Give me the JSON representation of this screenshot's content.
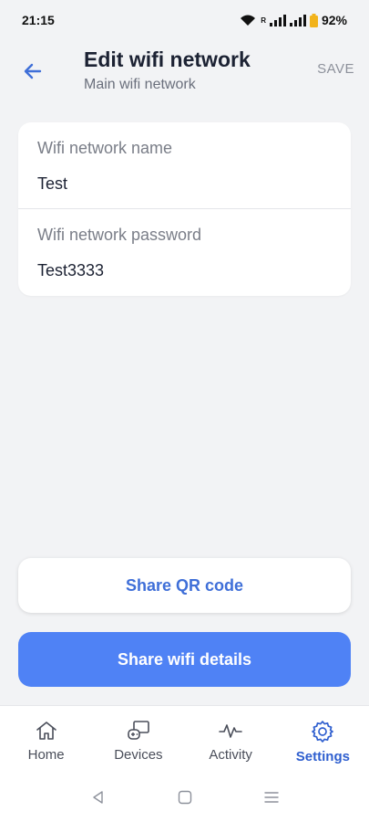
{
  "status_bar": {
    "time": "21:15",
    "roaming_indicator": "R",
    "battery": "92%",
    "icons": [
      "wifi-icon",
      "signal-icon",
      "signal-icon",
      "battery-icon"
    ]
  },
  "header": {
    "title": "Edit wifi network",
    "subtitle": "Main wifi network",
    "save_label": "SAVE",
    "back_icon": "arrow-left-icon"
  },
  "form": {
    "fields": [
      {
        "label": "Wifi network name",
        "value": "Test"
      },
      {
        "label": "Wifi network password",
        "value": "Test3333"
      }
    ]
  },
  "actions": {
    "share_qr_label": "Share QR code",
    "share_details_label": "Share wifi details"
  },
  "bottom_nav": {
    "items": [
      {
        "label": "Home",
        "icon": "home-icon",
        "active": false
      },
      {
        "label": "Devices",
        "icon": "devices-icon",
        "active": false
      },
      {
        "label": "Activity",
        "icon": "activity-icon",
        "active": false
      },
      {
        "label": "Settings",
        "icon": "gear-icon",
        "active": true
      }
    ]
  },
  "system_nav": {
    "icons": [
      "back-triangle-icon",
      "home-square-icon",
      "recents-menu-icon"
    ]
  },
  "colors": {
    "accent": "#4f82f5",
    "accent_text": "#3f6fd8",
    "active_nav": "#2f5fcf",
    "background": "#f2f3f5"
  }
}
